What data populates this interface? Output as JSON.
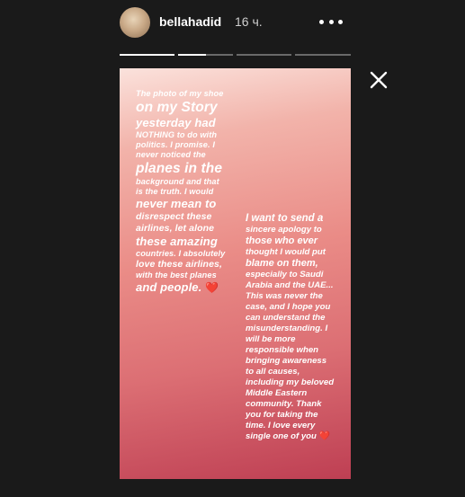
{
  "header": {
    "username": "bellahadid",
    "time": "16 ч."
  },
  "icons": {
    "more": "more-options-icon",
    "close": "close-icon"
  },
  "progress": {
    "segments": [
      {
        "state": "complete",
        "fill": 1.0
      },
      {
        "state": "current",
        "fill": 0.5
      },
      {
        "state": "upcoming",
        "fill": 0
      },
      {
        "state": "upcoming",
        "fill": 0
      }
    ]
  },
  "story": {
    "message_1": [
      "The photo of my shoe",
      "on my Story",
      "yesterday had",
      "NOTHING to do with",
      "politics. I promise. I",
      "never noticed the",
      "planes in the",
      "background and that",
      "is the truth. I would",
      "never mean to",
      "disrespect these",
      "airlines, let alone",
      "these amazing",
      "countries. I absolutely",
      "love these airlines,",
      "with the best planes",
      "and people."
    ],
    "message_2": [
      "I want to send a",
      "sincere apology to",
      "those who ever",
      "thought I would put",
      "blame on them,",
      "especially to Saudi",
      "Arabia and the UAE...",
      "This was never the",
      "case, and I hope you",
      "can understand the",
      "misunderstanding. I",
      "will be more",
      "responsible when",
      "bringing awareness",
      "to all causes,",
      "including my beloved",
      "Middle Eastern",
      "community. Thank",
      "you for taking the",
      "time. I love every",
      "single one of you"
    ],
    "heart_1": "❤️",
    "heart_2": "❤️"
  },
  "colors": {
    "background": "#1a1a1a",
    "story_top": "#fbe2dc",
    "story_bottom": "#be3f53"
  }
}
